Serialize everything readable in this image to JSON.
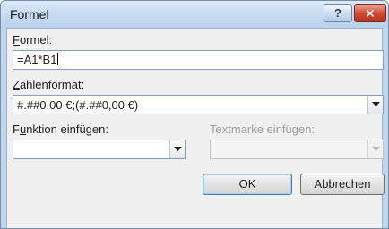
{
  "window": {
    "title": "Formel",
    "help_label": "?",
    "close_label": "✕"
  },
  "formula": {
    "label_accel": "F",
    "label_rest": "ormel:",
    "value": "=A1*B1"
  },
  "number_format": {
    "label_accel": "Z",
    "label_rest": "ahlenformat:",
    "value": "#.##0,00 €;(#.##0,00 €)"
  },
  "insert_function": {
    "label_pre": "F",
    "label_accel": "u",
    "label_rest": "nktion einfügen:",
    "value": ""
  },
  "insert_bookmark": {
    "label": "Textmarke einfügen:",
    "value": "",
    "enabled": false
  },
  "buttons": {
    "ok": "OK",
    "cancel": "Abbrechen"
  }
}
